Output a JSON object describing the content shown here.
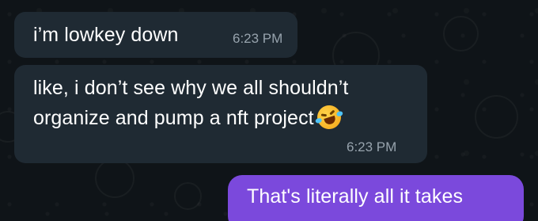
{
  "messages": [
    {
      "text": "i’m lowkey down",
      "time": "6:23 PM",
      "direction": "incoming"
    },
    {
      "line1": "like, i don’t see why we all shouldn’t",
      "line2": "organize and pump a nft project",
      "emoji": "rolling-on-floor-laughing",
      "time": "6:23 PM",
      "direction": "incoming"
    },
    {
      "text": "That's literally all it takes",
      "direction": "outgoing"
    }
  ],
  "colors": {
    "background": "#0f1418",
    "incoming_bubble": "#1f2a33",
    "outgoing_bubble": "#7b49dc",
    "timestamp": "#97a3ad"
  }
}
